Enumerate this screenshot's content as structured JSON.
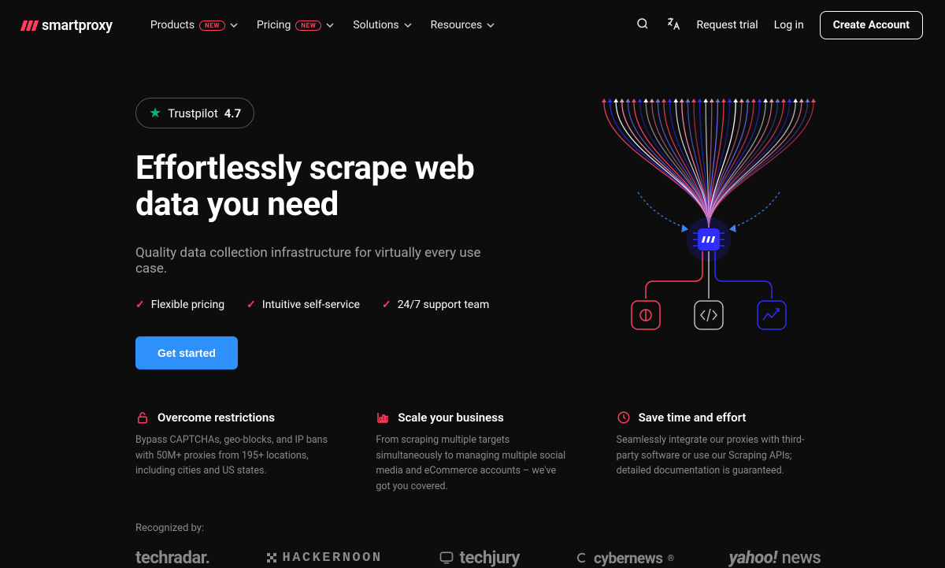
{
  "brand": "smartproxy",
  "nav": {
    "items": [
      {
        "label": "Products",
        "new": true
      },
      {
        "label": "Pricing",
        "new": true
      },
      {
        "label": "Solutions",
        "new": false
      },
      {
        "label": "Resources",
        "new": false
      }
    ],
    "new_badge": "NEW",
    "request_trial": "Request trial",
    "login": "Log in",
    "create_account": "Create Account"
  },
  "hero": {
    "trustpilot_label": "Trustpilot",
    "trustpilot_score": "4.7",
    "headline": "Effortlessly scrape web data you need",
    "subtitle": "Quality data collection infrastructure for virtually every use case.",
    "checks": [
      "Flexible pricing",
      "Intuitive self-service",
      "24/7 support team"
    ],
    "cta": "Get started"
  },
  "features": [
    {
      "icon": "lock-icon",
      "title": "Overcome restrictions",
      "desc": "Bypass CAPTCHAs, geo-blocks, and IP bans with 50M+ proxies from 195+ locations, including cities and US states."
    },
    {
      "icon": "chart-icon",
      "title": "Scale your business",
      "desc": "From scraping multiple targets simultaneously to managing multiple social media and eCommerce accounts – we've got you covered."
    },
    {
      "icon": "clock-icon",
      "title": "Save time and effort",
      "desc": "Seamlessly integrate our proxies with third-party software or use our Scraping APIs; detailed documentation is guaranteed."
    }
  ],
  "recognized": {
    "label": "Recognized by:",
    "brands": [
      "techradar.",
      "HACKERNOON",
      "techjury",
      "cybernews",
      "yahoo!news"
    ]
  }
}
